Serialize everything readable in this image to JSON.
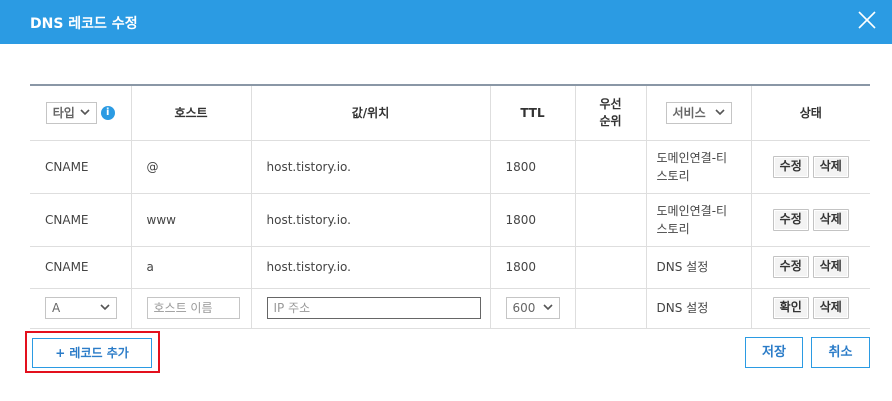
{
  "dialog": {
    "title": "DNS 레코드 수정"
  },
  "columns": {
    "type_select": "타입",
    "host": "호스트",
    "value": "값/위치",
    "ttl": "TTL",
    "priority_line1": "우선",
    "priority_line2": "순위",
    "service_select": "서비스",
    "state": "상태"
  },
  "records": [
    {
      "type": "CNAME",
      "host": "@",
      "value": "host.tistory.io.",
      "ttl": "1800",
      "priority": "",
      "service_line1": "도메인연결-티",
      "service_line2": "스토리",
      "edit_label": "수정",
      "delete_label": "삭제"
    },
    {
      "type": "CNAME",
      "host": "www",
      "value": "host.tistory.io.",
      "ttl": "1800",
      "priority": "",
      "service_line1": "도메인연결-티",
      "service_line2": "스토리",
      "edit_label": "수정",
      "delete_label": "삭제"
    },
    {
      "type": "CNAME",
      "host": "a",
      "value": "host.tistory.io.",
      "ttl": "1800",
      "priority": "",
      "service": "DNS 설정",
      "edit_label": "수정",
      "delete_label": "삭제"
    }
  ],
  "new_record": {
    "type_value": "A",
    "host_placeholder": "호스트 이름",
    "value_placeholder": "IP 주소",
    "ttl_value": "600",
    "service": "DNS 설정",
    "confirm_label": "확인",
    "delete_label": "삭제"
  },
  "footer": {
    "add_record_label": "+ 레코드 추가",
    "save_label": "저장",
    "cancel_label": "취소"
  },
  "colors": {
    "header": "#2b9be3",
    "button_border": "#2b9be3",
    "highlight": "#e3101d"
  },
  "icons": {
    "close": "close-icon",
    "info": "info-icon",
    "dropdown": "chevron-down-icon"
  }
}
